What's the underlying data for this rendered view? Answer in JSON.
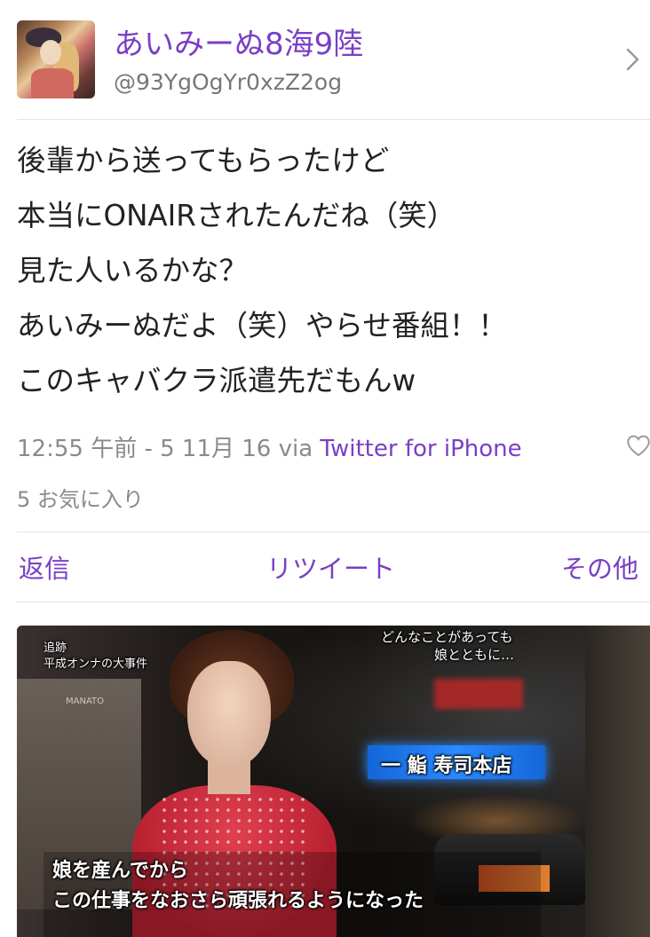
{
  "user": {
    "display_name": "あいみーぬ8海9陸",
    "handle": "@93YgOgYr0xzZ2og"
  },
  "tweet": {
    "lines": [
      "後輩から送ってもらったけど",
      "本当にONAIRされたんだね（笑）",
      "見た人いるかな？",
      "あいみーぬだよ（笑）やらせ番組！！",
      "このキャバクラ派遣先だもんw"
    ],
    "timestamp": "12:55 午前 - 5 11月 16 via ",
    "via_app": "Twitter for iPhone",
    "favorites": "5 お気に入り"
  },
  "actions": {
    "reply": "返信",
    "retweet": "リツイート",
    "more": "その他"
  },
  "photo": {
    "caption_top_1": "どんなことがあっても",
    "caption_top_2": "娘とともに…",
    "corner_1": "追跡",
    "corner_2": "平成オンナの大事件",
    "left_sign": "MANATO",
    "neon_sign": "一 鮨 寿司本店",
    "subtitle_1": "娘を産んでから",
    "subtitle_2": "この仕事をなおさら頑張れるようになった"
  },
  "colors": {
    "accent": "#7a3fc6",
    "meta_gray": "#8a8a8a"
  }
}
